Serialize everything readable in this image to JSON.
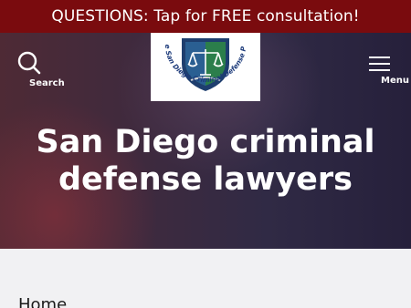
{
  "banner": {
    "text": "QUESTIONS: Tap for FREE consultation!"
  },
  "header": {
    "search_label": "Search",
    "menu_label": "Menu",
    "logo_text": "The San Diego Criminal Defense Pros"
  },
  "hero": {
    "title": "San Diego criminal defense lawyers"
  },
  "breadcrumb": {
    "home": "Home"
  },
  "colors": {
    "banner_bg": "#7a0b0e",
    "hero_bg": "#3a2a40",
    "logo_shield": "#1e3e6e",
    "logo_green": "#2e8a45"
  },
  "icons": [
    "search-icon",
    "hamburger-icon",
    "scales-of-justice-icon"
  ]
}
